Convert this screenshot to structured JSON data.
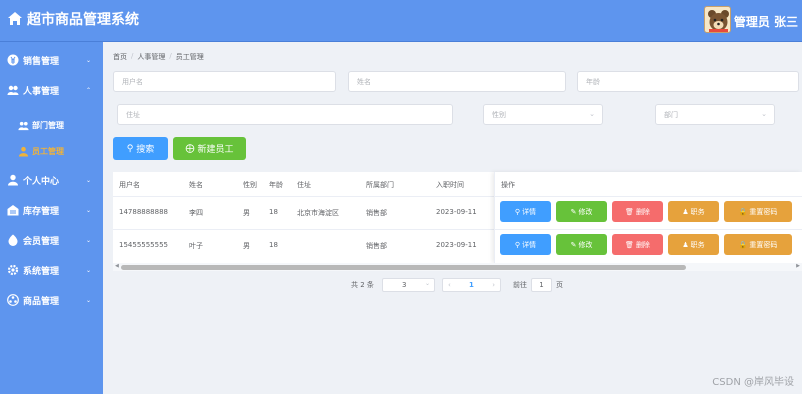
{
  "app": {
    "title": "超市商品管理系统",
    "user": "管理员 张三"
  },
  "sidebar": {
    "items": [
      {
        "label": "销售管理",
        "icon": "money-icon"
      },
      {
        "label": "人事管理",
        "icon": "users-icon"
      },
      {
        "label": "个人中心",
        "icon": "person-icon"
      },
      {
        "label": "库存管理",
        "icon": "warehouse-icon"
      },
      {
        "label": "会员管理",
        "icon": "member-icon"
      },
      {
        "label": "系统管理",
        "icon": "gear-icon"
      },
      {
        "label": "商品管理",
        "icon": "goods-icon"
      }
    ],
    "sub_items": [
      {
        "label": "部门管理",
        "icon": "department-icon"
      },
      {
        "label": "员工管理",
        "icon": "employee-icon"
      }
    ]
  },
  "breadcrumb": {
    "home": "首页",
    "parent": "人事管理",
    "current": "员工管理",
    "sep": "/"
  },
  "filters": {
    "username_placeholder": "用户名",
    "name_placeholder": "姓名",
    "age_placeholder": "年龄",
    "address_placeholder": "住址",
    "gender_placeholder": "性别",
    "department_placeholder": "部门"
  },
  "actions": {
    "search": "搜索",
    "create": "新建员工"
  },
  "table": {
    "headers": {
      "username": "用户名",
      "name": "姓名",
      "gender": "性别",
      "age": "年龄",
      "address": "住址",
      "department": "所属部门",
      "hire_date": "入职时间",
      "ops": "操作"
    },
    "rows": [
      {
        "username": "14788888888",
        "name": "李四",
        "gender": "男",
        "age": "18",
        "address": "北京市海淀区",
        "department": "销售部",
        "hire_date": "2023-09-11"
      },
      {
        "username": "15455555555",
        "name": "叶子",
        "gender": "男",
        "age": "18",
        "address": "",
        "department": "销售部",
        "hire_date": "2023-09-11"
      }
    ],
    "op_labels": {
      "detail": "详情",
      "edit": "修改",
      "delete": "删除",
      "position": "职务",
      "reset": "重置密码"
    }
  },
  "pagination": {
    "total": "共 2 条",
    "page_size": "3",
    "current_page": "1",
    "goto_label": "前往",
    "goto_value": "1",
    "page_unit": "页"
  },
  "watermark": "CSDN @岸风毕设"
}
